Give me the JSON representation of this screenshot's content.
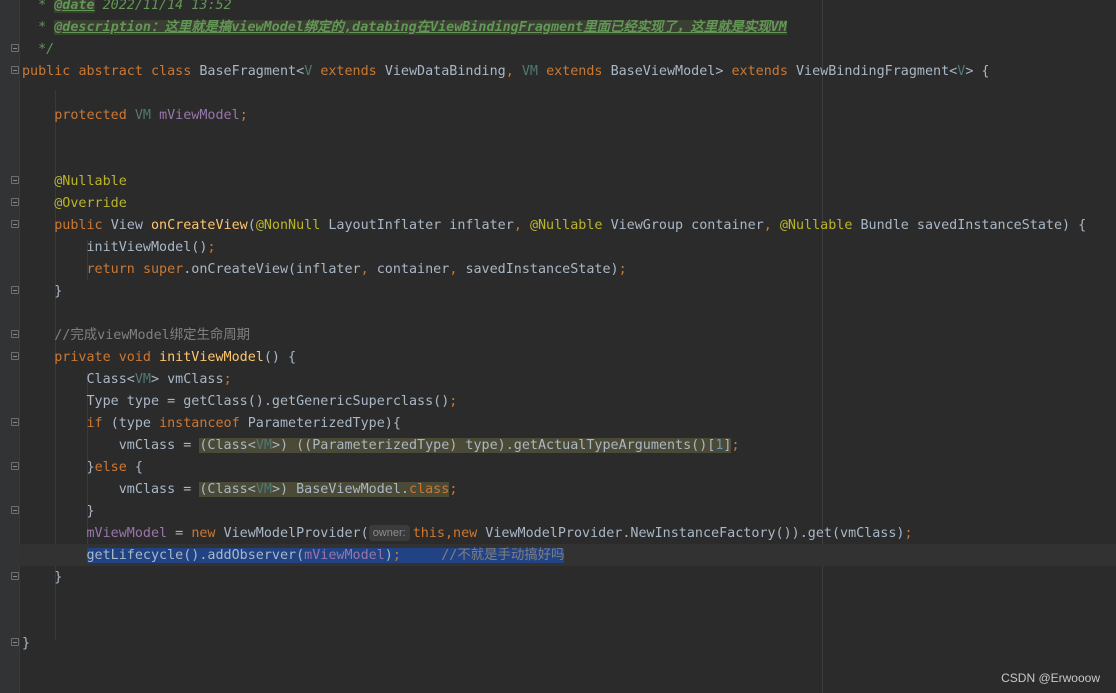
{
  "doc_comment": {
    "star": "*",
    "date_tag": "@date",
    "date_value": "2022/11/14 13:52",
    "desc_tag": "@description",
    "desc_value": "：这里就是搞viewModel绑定的,databing在ViewBindingFragment里面已经实现了，这里就是实现VM",
    "end": "*/"
  },
  "class_decl": {
    "public": "public",
    "abstract": "abstract",
    "class_kw": "class",
    "name": "BaseFragment<",
    "tp_v": "V",
    "extends1": "extends",
    "t1": "ViewDataBinding",
    "comma": ",",
    "tp_vm": "VM",
    "extends2": "extends",
    "t2": "BaseViewModel>",
    "extends3": "extends",
    "t3": "ViewBindingFragment<",
    "tp_v2": "V",
    "tail": "> {"
  },
  "field_decl": {
    "protected": "protected",
    "type": "VM",
    "name": "mViewModel",
    "semi": ";"
  },
  "ann_nullable": "@Nullable",
  "ann_override": "@Override",
  "on_create": {
    "public": "public",
    "ret": "View",
    "name": "onCreateView",
    "p_open": "(",
    "a1": "@NonNull",
    "p1": "LayoutInflater inflater",
    "c1": ",",
    "a2": "@Nullable",
    "p2": "ViewGroup container",
    "c2": ",",
    "a3": "@Nullable",
    "p3": "Bundle savedInstanceState) {"
  },
  "call_init": {
    "text": "initViewModel()",
    "semi": ";"
  },
  "return_line": {
    "ret": "return",
    "sup": "super",
    "rest": ".onCreateView(inflater",
    "c1": ",",
    "p2": "container",
    "c2": ",",
    "p3": "savedInstanceState)",
    "semi": ";"
  },
  "close_brace": "}",
  "line_comment": "//完成viewModel绑定生命周期",
  "init_decl": {
    "private": "private",
    "void_kw": "void",
    "name": "initViewModel",
    "tail": "() {"
  },
  "class_var": {
    "a": "Class<",
    "tp": "VM",
    "b": "> vmClass",
    "semi": ";"
  },
  "type_var": {
    "text": "Type type = getClass().getGenericSuperclass()",
    "semi": ";"
  },
  "if_line": {
    "if_kw": "if",
    "a": "(type",
    "inst": "instanceof",
    "b": "ParameterizedType){"
  },
  "assign1": {
    "a": "vmClass = ",
    "h1": "(Class<",
    "tp": "VM",
    "h2": ">) ((ParameterizedType) type).getActualTypeArguments()[",
    "num": "1",
    "h3": "]",
    "semi": ";"
  },
  "else_line": {
    "a": "}",
    "else_kw": "else",
    "b": " {"
  },
  "assign2": {
    "a": "vmClass = ",
    "h1": "(Class<",
    "tp": "VM",
    "h2": ">) BaseViewModel.",
    "cls": "class",
    "semi": ";"
  },
  "provider_line": {
    "fld": "mViewModel",
    "eq": " = ",
    "new1": "new",
    "a": " ViewModelProvider(",
    "hint": "owner:",
    "this_kw": "this",
    "comma": ",",
    "new2": "new",
    "b": " ViewModelProvider.NewInstanceFactory()).get(vmClass)",
    "semi": ";"
  },
  "lifecycle_line": {
    "a": "getLifecycle().addObserver(",
    "fld": "mViewModel",
    "b": ")",
    "semi": ";",
    "gap": "     ",
    "cmt": "//不就是手动搞好吗"
  },
  "watermark": "CSDN @Erwooow"
}
